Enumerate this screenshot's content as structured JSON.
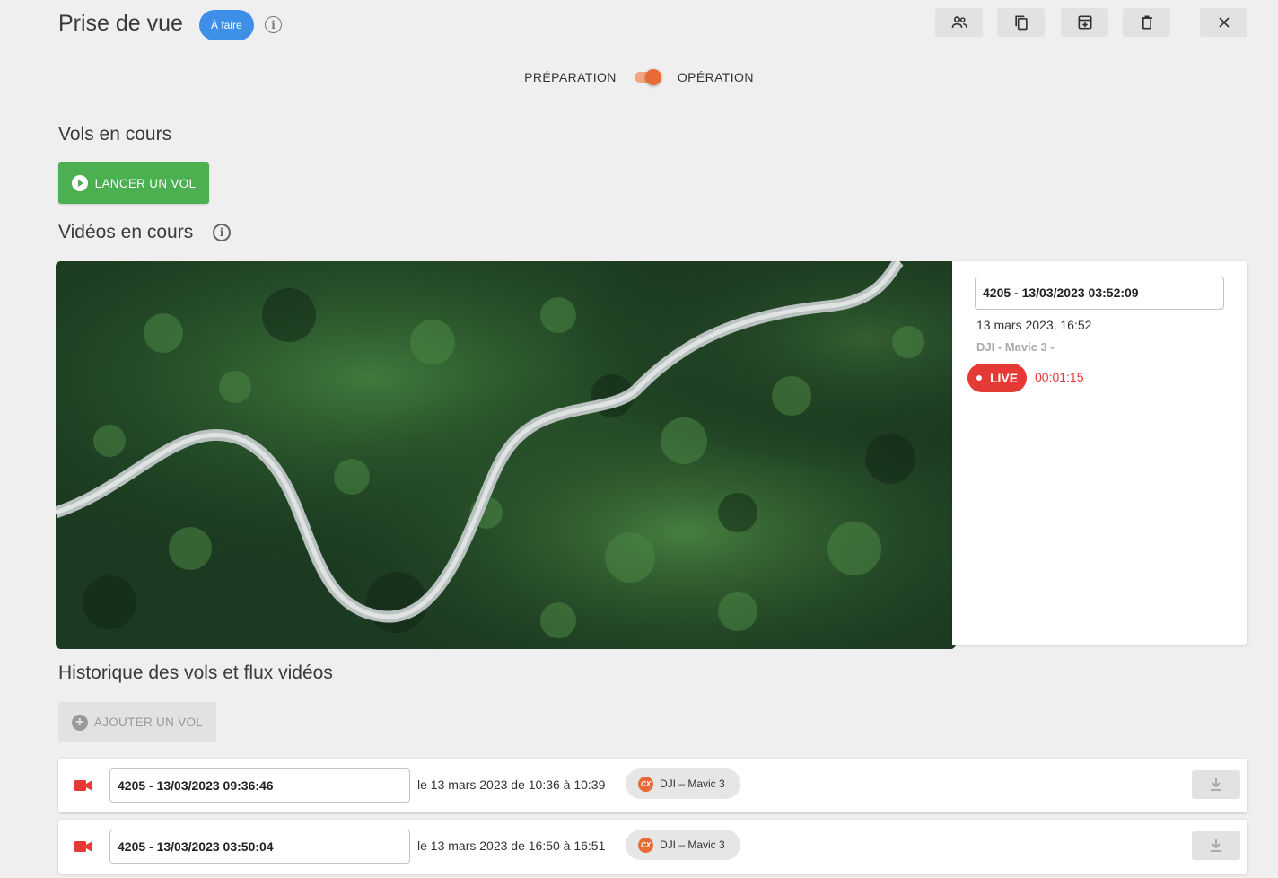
{
  "header": {
    "title": "Prise de vue",
    "status": "À faire",
    "toolbar_icons": [
      "users-icon",
      "copy-icon",
      "archive-icon",
      "trash-icon",
      "close-icon"
    ]
  },
  "mode": {
    "left_label": "PRÉPARATION",
    "right_label": "OPÉRATION",
    "active": "OPÉRATION"
  },
  "flights": {
    "title": "Vols en cours",
    "launch_label": "LANCER UN VOL"
  },
  "videos": {
    "title": "Vidéos en cours",
    "current": {
      "name": "4205 - 13/03/2023 03:52:09",
      "date": "13 mars 2023, 16:52",
      "drone": "DJI - Mavic 3 -",
      "live_label": "LIVE",
      "duration": "00:01:15"
    }
  },
  "history": {
    "title": "Historique des vols et flux vidéos",
    "add_label": "AJOUTER UN VOL",
    "rows": [
      {
        "name": "4205 - 13/03/2023 09:36:46",
        "time": "le 13 mars 2023 de 10:36 à 10:39",
        "drone": "DJI – Mavic 3",
        "logo": "CX"
      },
      {
        "name": "4205 - 13/03/2023 03:50:04",
        "time": "le 13 mars 2023 de 16:50 à 16:51",
        "drone": "DJI – Mavic 3",
        "logo": "CX"
      }
    ]
  },
  "colors": {
    "badge_blue": "#3d8fe8",
    "toggle_orange": "#ea6a36",
    "launch_green": "#4caf50",
    "live_red": "#e53935"
  }
}
